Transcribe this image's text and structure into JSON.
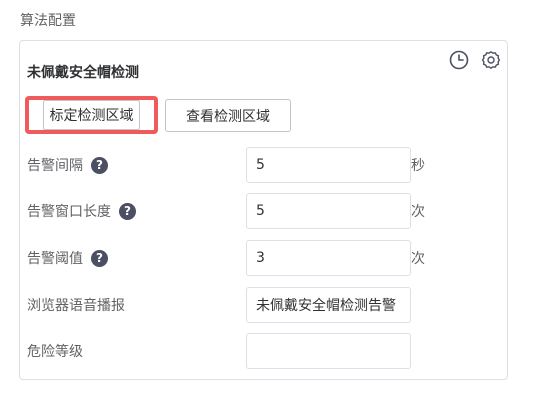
{
  "section": {
    "title": "算法配置"
  },
  "card": {
    "title": "未佩戴安全帽检测",
    "icons": {
      "history": "clock-icon",
      "settings": "gear-icon"
    },
    "buttons": {
      "mark_area": "标定检测区域",
      "view_area": "查看检测区域"
    },
    "fields": {
      "alarm_interval": {
        "label": "告警间隔",
        "value": "5",
        "unit": "秒",
        "help": "?"
      },
      "alarm_window": {
        "label": "告警窗口长度",
        "value": "5",
        "unit": "次",
        "help": "?"
      },
      "alarm_threshold": {
        "label": "告警阈值",
        "value": "3",
        "unit": "次",
        "help": "?"
      },
      "browser_voice": {
        "label": "浏览器语音播报",
        "value": "未佩戴安全帽检测告警"
      },
      "risk_level": {
        "label": "危险等级",
        "value": ""
      }
    }
  },
  "colors": {
    "highlight_border": "#f05a5a",
    "help_icon": "#4a4f63"
  }
}
